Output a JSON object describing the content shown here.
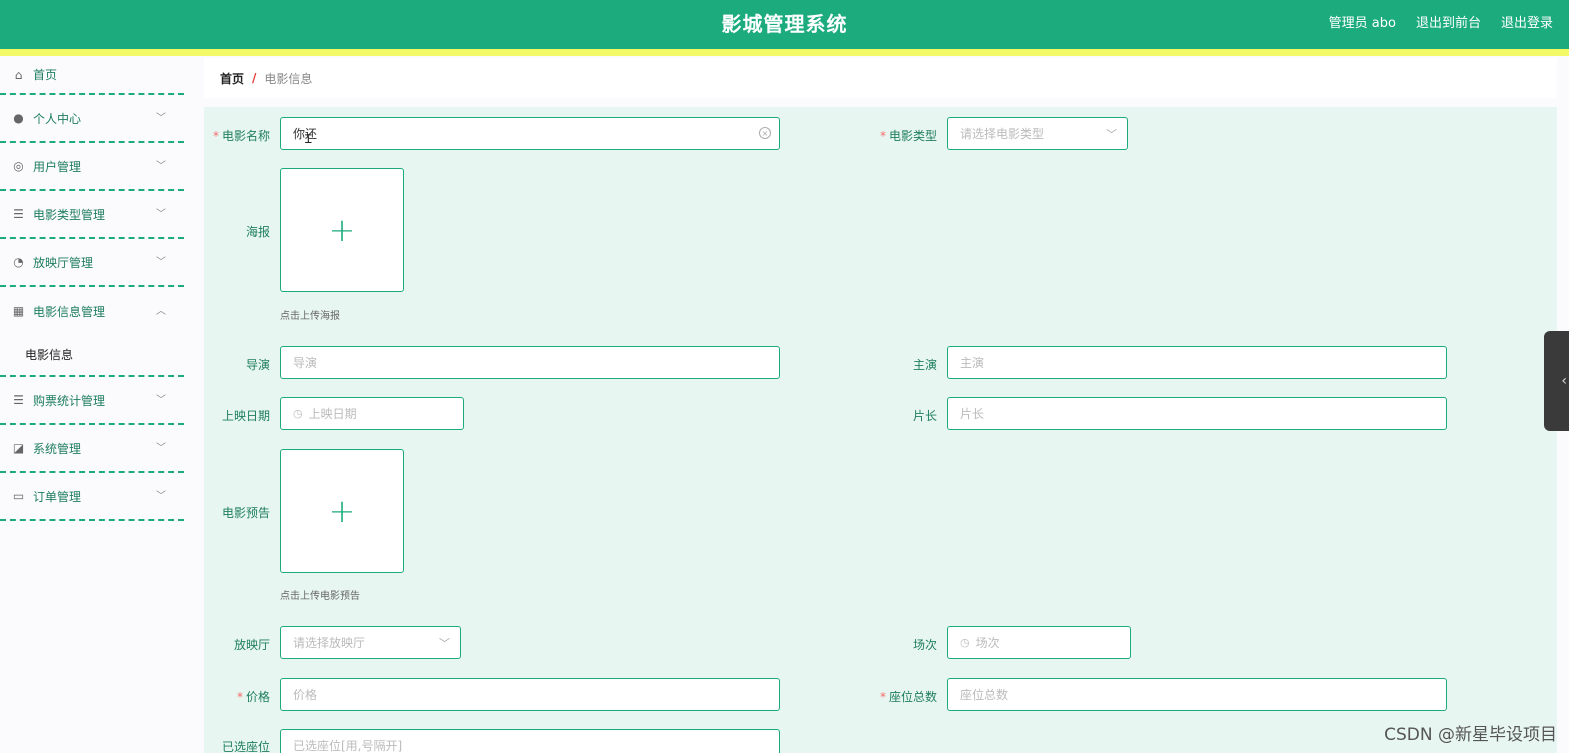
{
  "header": {
    "title": "影城管理系统",
    "admin": "管理员 abo",
    "to_front": "退出到前台",
    "logout": "退出登录"
  },
  "sidebar": {
    "items": [
      {
        "label": "首页",
        "icon": "home-icon"
      },
      {
        "label": "个人中心",
        "icon": "user-icon"
      },
      {
        "label": "用户管理",
        "icon": "lifebuoy-icon"
      },
      {
        "label": "电影类型管理",
        "icon": "list-icon"
      },
      {
        "label": "放映厅管理",
        "icon": "compass-icon"
      },
      {
        "label": "电影信息管理",
        "icon": "grid-icon",
        "expanded": true
      },
      {
        "label": "购票统计管理",
        "icon": "list-icon"
      },
      {
        "label": "系统管理",
        "icon": "chart-icon"
      },
      {
        "label": "订单管理",
        "icon": "monitor-icon"
      }
    ],
    "submenu": {
      "label": "电影信息"
    }
  },
  "breadcrumb": {
    "home": "首页",
    "sep": "/",
    "current": "电影信息"
  },
  "form": {
    "movie_name": {
      "label": "电影名称",
      "value": "你还"
    },
    "movie_type": {
      "label": "电影类型",
      "placeholder": "请选择电影类型"
    },
    "poster": {
      "label": "海报",
      "hint": "点击上传海报"
    },
    "director": {
      "label": "导演",
      "placeholder": "导演"
    },
    "actor": {
      "label": "主演",
      "placeholder": "主演"
    },
    "release_date": {
      "label": "上映日期",
      "placeholder": "上映日期"
    },
    "duration": {
      "label": "片长",
      "placeholder": "片长"
    },
    "trailer": {
      "label": "电影预告",
      "hint": "点击上传电影预告"
    },
    "hall": {
      "label": "放映厅",
      "placeholder": "请选择放映厅"
    },
    "session": {
      "label": "场次",
      "placeholder": "场次"
    },
    "price": {
      "label": "价格",
      "placeholder": "价格"
    },
    "seat_total": {
      "label": "座位总数",
      "placeholder": "座位总数"
    },
    "seats_selected": {
      "label": "已选座位",
      "placeholder": "已选座位[用,号隔开]"
    }
  },
  "watermark": "CSDN @新星毕设项目",
  "colors": {
    "primary": "#1bab7d",
    "strip": "#f3f967",
    "form_bg": "#e8f6f1"
  }
}
